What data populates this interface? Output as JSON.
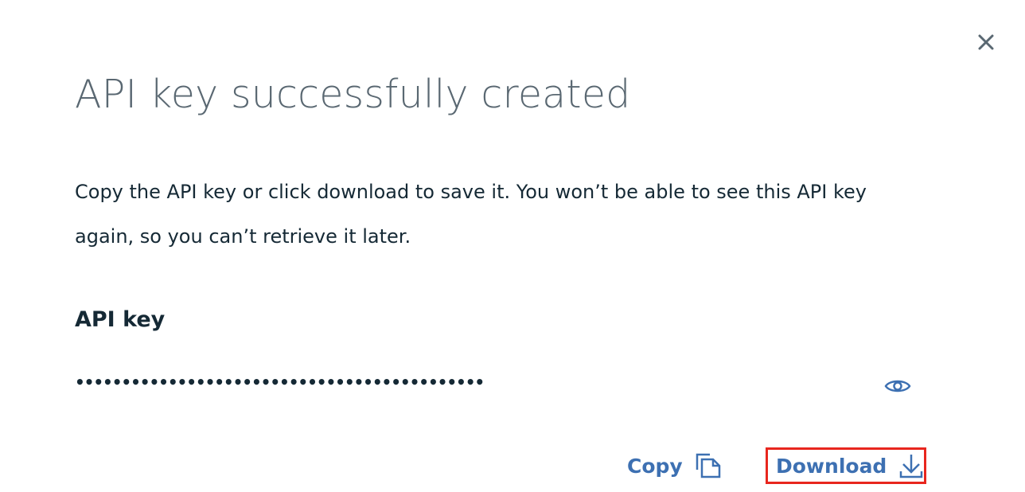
{
  "modal": {
    "title": "API key successfully created",
    "description": "Copy the API key or click download to save it. You won’t be able to see this API key again, so you can’t retrieve it later.",
    "api_key_label": "API key",
    "api_key_masked": "••••••••••••••••••••••••••••••••••••••••••••"
  },
  "actions": {
    "copy_label": "Copy",
    "download_label": "Download"
  },
  "icons": {
    "close": "close-icon",
    "reveal": "eye-icon",
    "copy": "copy-icon",
    "download": "download-icon"
  },
  "colors": {
    "link": "#3d70b2",
    "title": "#5a6872",
    "text": "#152935",
    "highlight": "#e8261e"
  }
}
